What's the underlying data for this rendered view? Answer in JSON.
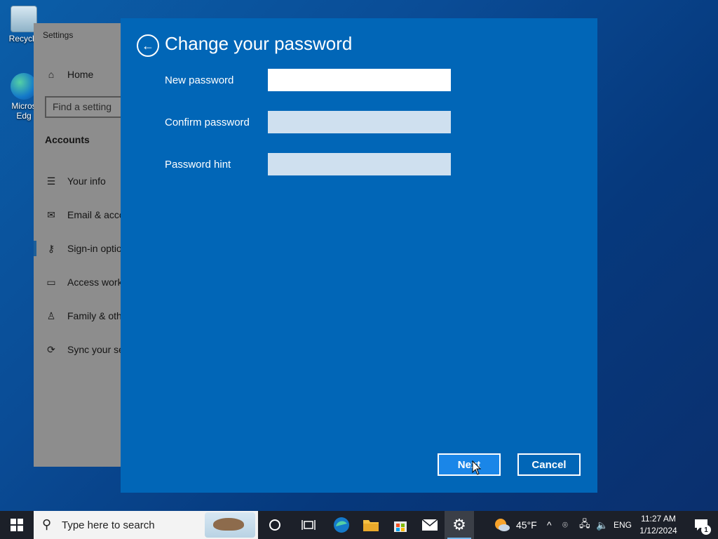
{
  "desktop": {
    "icons": [
      {
        "label": "Recycle",
        "icon": "recycle-bin-icon"
      },
      {
        "label": "Micros Edg",
        "icon": "edge-icon"
      }
    ]
  },
  "settings": {
    "title": "Settings",
    "home": "Home",
    "search_placeholder": "Find a setting",
    "section": "Accounts",
    "nav": [
      {
        "label": "Your info",
        "icon": "person-info-icon"
      },
      {
        "label": "Email & acco",
        "icon": "mail-icon"
      },
      {
        "label": "Sign-in optio",
        "icon": "key-icon"
      },
      {
        "label": "Access work",
        "icon": "briefcase-icon"
      },
      {
        "label": "Family & oth",
        "icon": "person-add-icon"
      },
      {
        "label": "Sync your se",
        "icon": "sync-icon"
      }
    ]
  },
  "dialog": {
    "title": "Change your password",
    "fields": {
      "new_password": {
        "label": "New password",
        "value": ""
      },
      "confirm_password": {
        "label": "Confirm password",
        "value": ""
      },
      "password_hint": {
        "label": "Password hint",
        "value": ""
      }
    },
    "next_label": "Next",
    "cancel_label": "Cancel",
    "accent": "#0166b7"
  },
  "taskbar": {
    "search_text": "Type here to search",
    "weather": "45°F",
    "language": "ENG",
    "time": "11:27 AM",
    "date": "1/12/2024",
    "notifications": "1"
  }
}
